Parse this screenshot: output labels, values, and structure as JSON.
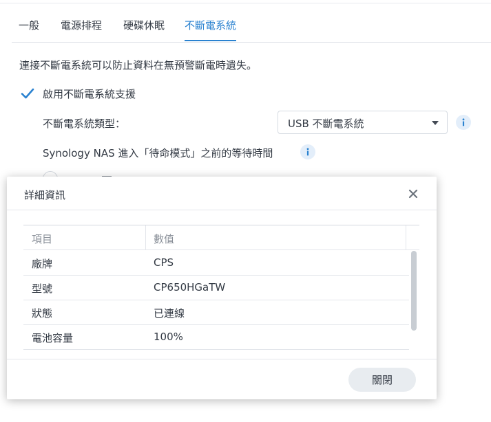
{
  "tabs": [
    {
      "label": "一般",
      "active": false
    },
    {
      "label": "電源排程",
      "active": false
    },
    {
      "label": "硬碟休眠",
      "active": false
    },
    {
      "label": "不斷電系統",
      "active": true
    }
  ],
  "ups": {
    "description": "連接不斷電系統可以防止資料在無預警斷電時遺失。",
    "enable_label": "啟用不斷電系統支援",
    "enable_checked": true,
    "type_label": "不斷電系統類型：",
    "type_value": "USB 不斷電系統",
    "wait_label": "Synology NAS 進入「待命模式」之前的等待時間"
  },
  "modal": {
    "title": "詳細資訊",
    "columns": [
      "項目",
      "數值"
    ],
    "rows": [
      {
        "item": "廠牌",
        "value": "CPS"
      },
      {
        "item": "型號",
        "value": "CP650HGaTW"
      },
      {
        "item": "狀態",
        "value": "已連線"
      },
      {
        "item": "電池容量",
        "value": "100%"
      }
    ],
    "close_label": "關閉"
  },
  "icons": {
    "checkbox": "check-icon",
    "info": "info-icon",
    "dropdown": "caret-down-icon",
    "close": "close-icon"
  },
  "colors": {
    "accent": "#2a82d0",
    "info_bg": "#e3eefa",
    "button_bg": "#e8ecf0"
  }
}
